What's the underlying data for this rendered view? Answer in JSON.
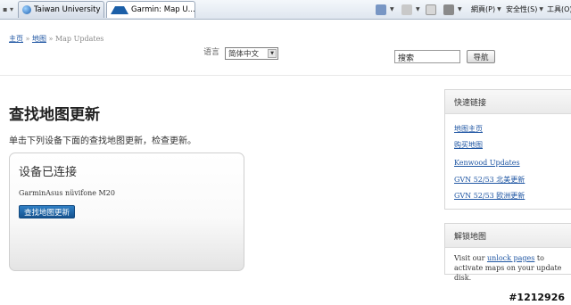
{
  "browser": {
    "tab_nav": "▪ ▾",
    "tabs": [
      {
        "label": "Taiwan University ...",
        "close": ""
      },
      {
        "label": "Garmin: Map U...",
        "close": "x"
      }
    ],
    "toolbar": {
      "page_menu": "網頁(P)",
      "safety_menu": "安全性(S)",
      "tools_menu": "工具(O)"
    }
  },
  "breadcrumb": {
    "home": "主页",
    "sep1": " » ",
    "maps": "地图",
    "sep2": " » ",
    "current": "Map Updates"
  },
  "language": {
    "label": "语言",
    "selected": "简体中文"
  },
  "search": {
    "value": "搜索",
    "button": "导航"
  },
  "main": {
    "title": "查找地图更新",
    "instruction": "单击下列设备下面的查找地图更新，检查更新。"
  },
  "device_card": {
    "heading": "设备已连接",
    "device_name": "GarminAsus nüvifone M20",
    "find_button": "查找地图更新"
  },
  "quick_links": {
    "heading": "快速链接",
    "items": [
      "地图主页",
      "购买地图",
      "Kenwood Updates",
      "GVN 52/53 北美更新",
      "GVN 52/53 欧洲更新"
    ]
  },
  "unlock": {
    "heading": "解锁地图",
    "text_before": "Visit our ",
    "link": "unlock pages",
    "text_after": " to activate maps on your update disk."
  },
  "watermark": "#1212926"
}
